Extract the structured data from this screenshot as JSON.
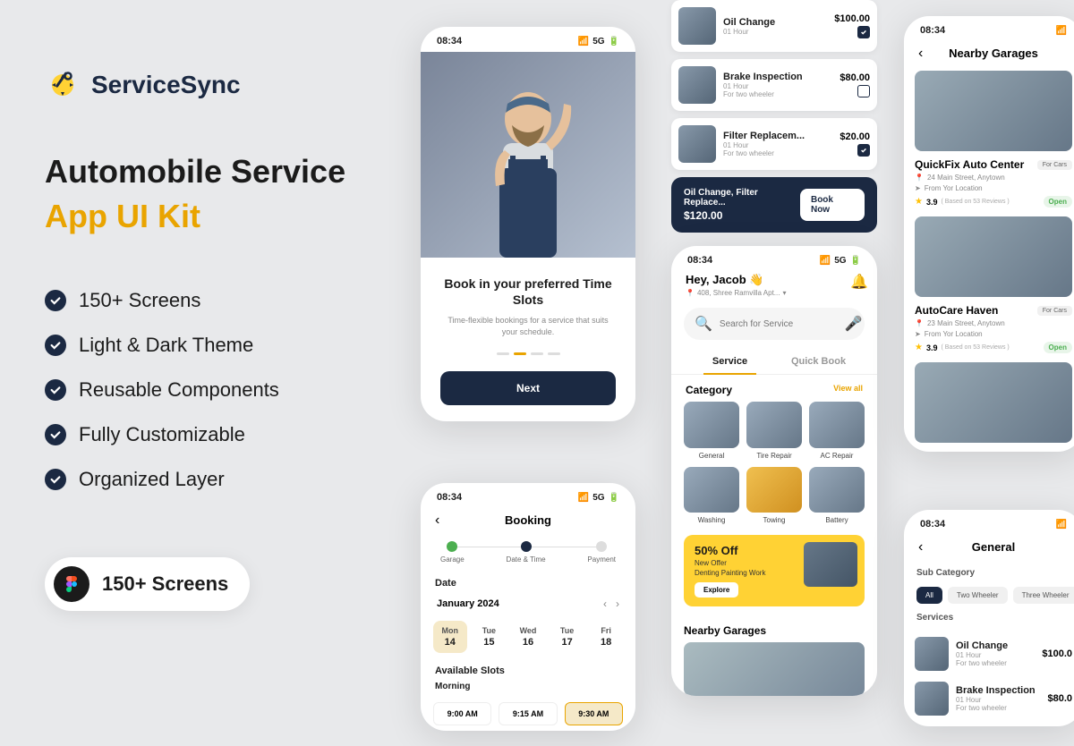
{
  "brand": "ServiceSync",
  "headline": "Automobile Service",
  "headline_accent": "App UI Kit",
  "features": [
    "150+ Screens",
    "Light & Dark Theme",
    "Reusable Components",
    "Fully Customizable",
    "Organized Layer"
  ],
  "pill": "150+ Screens",
  "status_time": "08:34",
  "status_net": "5G",
  "onboarding": {
    "title": "Book in your preferred Time Slots",
    "sub": "Time-flexible bookings for a service that suits your schedule.",
    "next": "Next"
  },
  "booking": {
    "title": "Booking",
    "steps": [
      "Garage",
      "Date & Time",
      "Payment"
    ],
    "date_label": "Date",
    "month": "January 2024",
    "days": [
      {
        "dow": "Mon",
        "num": "14",
        "active": true
      },
      {
        "dow": "Tue",
        "num": "15"
      },
      {
        "dow": "Wed",
        "num": "16"
      },
      {
        "dow": "Tue",
        "num": "17"
      },
      {
        "dow": "Fri",
        "num": "18"
      }
    ],
    "slots_label": "Available Slots",
    "period": "Morning",
    "slots": [
      "9:00 AM",
      "9:15 AM",
      "9:30 AM"
    ]
  },
  "services_top": [
    {
      "name": "Oil Change",
      "meta1": "01 Hour",
      "meta2": "",
      "price": "$100.00",
      "checked": true
    },
    {
      "name": "Brake Inspection",
      "meta1": "01 Hour",
      "meta2": "For two wheeler",
      "price": "$80.00",
      "checked": false
    },
    {
      "name": "Filter Replacem...",
      "meta1": "01 Hour",
      "meta2": "For two wheeler",
      "price": "$20.00",
      "checked": true
    }
  ],
  "book_bar": {
    "summary": "Oil Change, Filter Replace...",
    "total": "$120.00",
    "btn": "Book Now"
  },
  "home": {
    "greet": "Hey, Jacob 👋",
    "addr": "408, Shree Ramvilla Apt...",
    "search_placeholder": "Search for Service",
    "tabs": [
      "Service",
      "Quick Book"
    ],
    "cat_title": "Category",
    "view_all": "View all",
    "categories": [
      "General",
      "Tire Repair",
      "AC Repair",
      "Washing",
      "Towing",
      "Battery"
    ],
    "promo_title": "50% Off",
    "promo_sub1": "New Offer",
    "promo_sub2": "Denting Painting Work",
    "promo_btn": "Explore",
    "nearby_title": "Nearby Garages"
  },
  "garages": {
    "title": "Nearby Garages",
    "items": [
      {
        "name": "QuickFix Auto Center",
        "tag": "For Cars",
        "addr": "24 Main Street, Anytown",
        "from": "From Yor Location",
        "rating": "3.9",
        "reviews": "( Based on 53 Reviews )",
        "status": "Open"
      },
      {
        "name": "AutoCare Haven",
        "tag": "For Cars",
        "addr": "23 Main Street, Anytown",
        "from": "From Yor Location",
        "rating": "3.9",
        "reviews": "( Based on 53 Reviews )",
        "status": "Open"
      }
    ]
  },
  "general": {
    "title": "General",
    "subcat_label": "Sub Category",
    "chips": [
      "All",
      "Two Wheeler",
      "Three Wheeler"
    ],
    "services_label": "Services",
    "services": [
      {
        "name": "Oil Change",
        "meta1": "01 Hour",
        "meta2": "For two wheeler",
        "price": "$100.0"
      },
      {
        "name": "Brake Inspection",
        "meta1": "01 Hour",
        "meta2": "For two wheeler",
        "price": "$80.0"
      }
    ]
  }
}
